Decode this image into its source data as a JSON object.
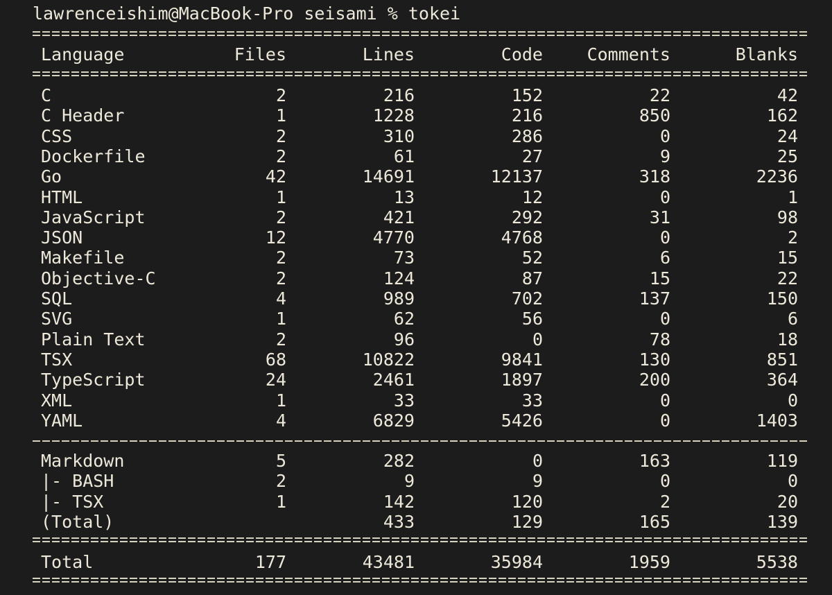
{
  "prompt": {
    "text": "lawrenceishim@MacBook-Pro seisami % tokei"
  },
  "table": {
    "headers": [
      "Language",
      "Files",
      "Lines",
      "Code",
      "Comments",
      "Blanks"
    ],
    "rows": [
      [
        "C",
        "2",
        "216",
        "152",
        "22",
        "42"
      ],
      [
        "C Header",
        "1",
        "1228",
        "216",
        "850",
        "162"
      ],
      [
        "CSS",
        "2",
        "310",
        "286",
        "0",
        "24"
      ],
      [
        "Dockerfile",
        "2",
        "61",
        "27",
        "9",
        "25"
      ],
      [
        "Go",
        "42",
        "14691",
        "12137",
        "318",
        "2236"
      ],
      [
        "HTML",
        "1",
        "13",
        "12",
        "0",
        "1"
      ],
      [
        "JavaScript",
        "2",
        "421",
        "292",
        "31",
        "98"
      ],
      [
        "JSON",
        "12",
        "4770",
        "4768",
        "0",
        "2"
      ],
      [
        "Makefile",
        "2",
        "73",
        "52",
        "6",
        "15"
      ],
      [
        "Objective-C",
        "2",
        "124",
        "87",
        "15",
        "22"
      ],
      [
        "SQL",
        "4",
        "989",
        "702",
        "137",
        "150"
      ],
      [
        "SVG",
        "1",
        "62",
        "56",
        "0",
        "6"
      ],
      [
        "Plain Text",
        "2",
        "96",
        "0",
        "78",
        "18"
      ],
      [
        "TSX",
        "68",
        "10822",
        "9841",
        "130",
        "851"
      ],
      [
        "TypeScript",
        "24",
        "2461",
        "1897",
        "200",
        "364"
      ],
      [
        "XML",
        "1",
        "33",
        "33",
        "0",
        "0"
      ],
      [
        "YAML",
        "4",
        "6829",
        "5426",
        "0",
        "1403"
      ]
    ],
    "markdown_rows": [
      [
        "Markdown",
        "5",
        "282",
        "0",
        "163",
        "119"
      ],
      [
        "|- BASH",
        "2",
        "9",
        "9",
        "0",
        "0"
      ],
      [
        "|- TSX",
        "1",
        "142",
        "120",
        "2",
        "20"
      ],
      [
        "(Total)",
        "",
        "433",
        "129",
        "165",
        "139"
      ]
    ],
    "total": [
      "Total",
      "177",
      "43481",
      "35984",
      "1959",
      "5538"
    ]
  }
}
